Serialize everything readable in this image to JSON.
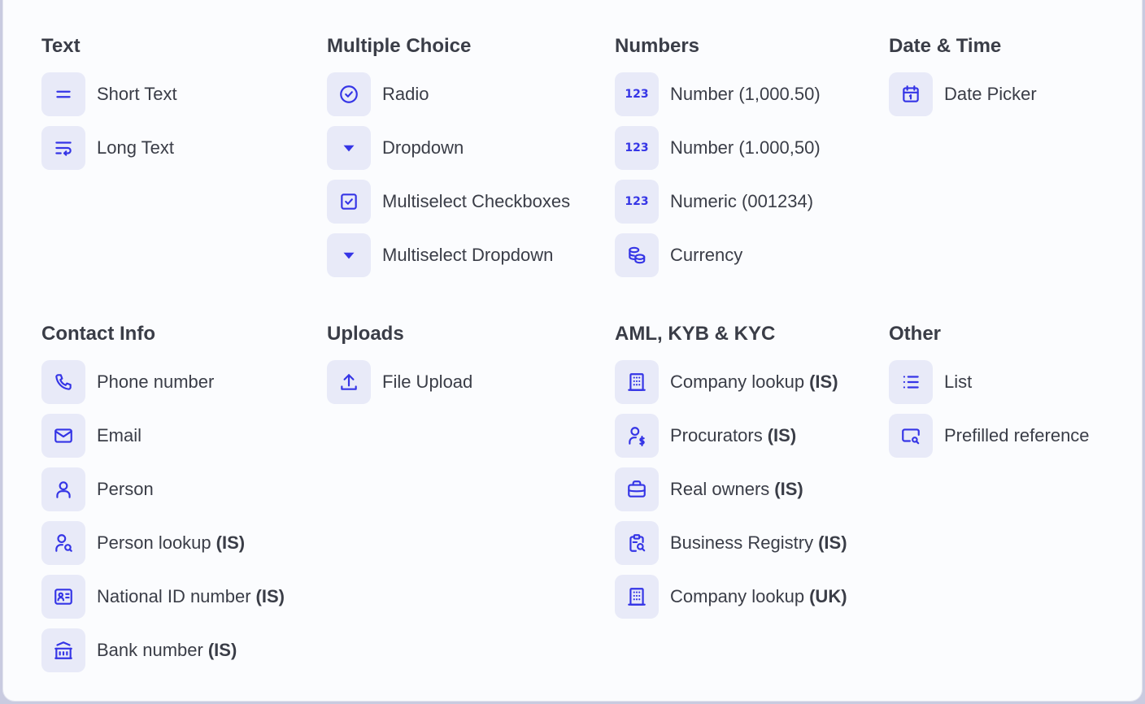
{
  "accent": "#3535e6",
  "sections": {
    "text": {
      "title": "Text",
      "items": [
        {
          "label": "Short Text",
          "icon": "equals-icon"
        },
        {
          "label": "Long Text",
          "icon": "wrap-text-icon"
        }
      ]
    },
    "multiple_choice": {
      "title": "Multiple Choice",
      "items": [
        {
          "label": "Radio",
          "icon": "check-circle-icon"
        },
        {
          "label": "Dropdown",
          "icon": "caret-down-icon"
        },
        {
          "label": "Multiselect Checkboxes",
          "icon": "check-square-icon"
        },
        {
          "label": "Multiselect Dropdown",
          "icon": "caret-down-icon"
        }
      ]
    },
    "numbers": {
      "title": "Numbers",
      "items": [
        {
          "label": "Number (1,000.50)",
          "icon_text": "123",
          "icon": "numbers-icon"
        },
        {
          "label": "Number (1.000,50)",
          "icon_text": "123",
          "icon": "numbers-icon"
        },
        {
          "label": "Numeric (001234)",
          "icon_text": "123",
          "icon": "numbers-icon"
        },
        {
          "label": "Currency",
          "icon": "coins-icon"
        }
      ]
    },
    "date_time": {
      "title": "Date & Time",
      "items": [
        {
          "label": "Date Picker",
          "icon": "calendar-icon"
        }
      ]
    },
    "contact_info": {
      "title": "Contact Info",
      "items": [
        {
          "label": "Phone number",
          "suffix": "",
          "icon": "phone-icon"
        },
        {
          "label": "Email",
          "suffix": "",
          "icon": "mail-icon"
        },
        {
          "label": "Person",
          "suffix": "",
          "icon": "user-icon"
        },
        {
          "label": "Person lookup",
          "suffix": "(IS)",
          "icon": "user-search-icon"
        },
        {
          "label": "National ID number",
          "suffix": "(IS)",
          "icon": "id-card-icon"
        },
        {
          "label": "Bank number",
          "suffix": "(IS)",
          "icon": "bank-icon"
        }
      ]
    },
    "uploads": {
      "title": "Uploads",
      "items": [
        {
          "label": "File Upload",
          "icon": "upload-icon"
        }
      ]
    },
    "aml": {
      "title": "AML, KYB & KYC",
      "items": [
        {
          "label": "Company lookup",
          "suffix": "(IS)",
          "icon": "building-icon"
        },
        {
          "label": "Procurators",
          "suffix": "(IS)",
          "icon": "user-dollar-icon"
        },
        {
          "label": "Real owners",
          "suffix": "(IS)",
          "icon": "briefcase-icon"
        },
        {
          "label": "Business Registry",
          "suffix": "(IS)",
          "icon": "clipboard-search-icon"
        },
        {
          "label": "Company lookup",
          "suffix": "(UK)",
          "icon": "building-icon"
        }
      ]
    },
    "other": {
      "title": "Other",
      "items": [
        {
          "label": "List",
          "icon": "list-icon"
        },
        {
          "label": "Prefilled reference",
          "icon": "screen-search-icon"
        }
      ]
    }
  }
}
